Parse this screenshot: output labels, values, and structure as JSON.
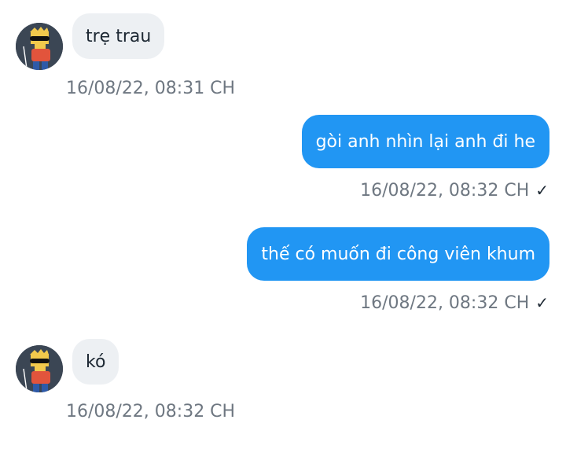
{
  "messages": [
    {
      "direction": "incoming",
      "text": "trẹ trau",
      "timestamp": "16/08/22,  08:31 CH"
    },
    {
      "direction": "outgoing",
      "text": "gòi anh nhìn lại anh đi he",
      "timestamp": "16/08/22,  08:32 CH",
      "status_icon": "check-icon"
    },
    {
      "direction": "outgoing",
      "text": "thế có muốn đi công viên khum",
      "timestamp": "16/08/22,  08:32 CH",
      "status_icon": "check-icon"
    },
    {
      "direction": "incoming",
      "text": "kó",
      "timestamp": "16/08/22,  08:32 CH"
    }
  ],
  "checkmark": "✓",
  "colors": {
    "outgoing_bubble": "#2196f3",
    "incoming_bubble": "#edf0f3",
    "timestamp": "#6e7781"
  }
}
